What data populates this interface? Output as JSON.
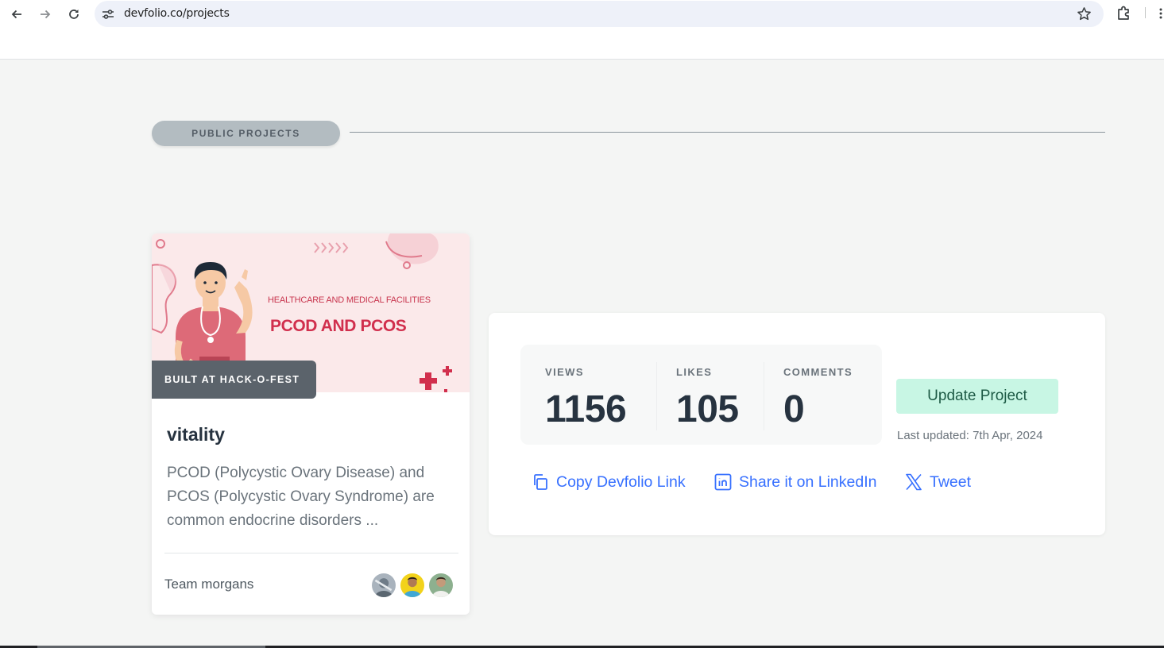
{
  "browser": {
    "url": "devfolio.co/projects",
    "icons": [
      "back-arrow-icon",
      "forward-arrow-icon",
      "reload-icon",
      "site-settings-icon",
      "star-icon",
      "extensions-icon",
      "menu-icon"
    ]
  },
  "section": {
    "label": "PUBLIC PROJECTS"
  },
  "project": {
    "cover": {
      "subtitle": "HEALTHCARE AND MEDICAL FACILITIES",
      "title": "PCOD AND PCOS"
    },
    "badge": "BUILT AT HACK-O-FEST",
    "name": "vitality",
    "description": "PCOD (Polycystic Ovary Disease) and PCOS (Polycystic Ovary Syndrome) are common endocrine disorders ...",
    "team": "Team morgans",
    "member_count": 3
  },
  "stats": {
    "views_label": "VIEWS",
    "views": "1156",
    "likes_label": "LIKES",
    "likes": "105",
    "comments_label": "COMMENTS",
    "comments": "0"
  },
  "actions": {
    "update_label": "Update Project",
    "last_updated": "Last updated: 7th Apr, 2024",
    "copy_link": "Copy Devfolio Link",
    "linkedin": "Share it on LinkedIn",
    "tweet": "Tweet"
  },
  "colors": {
    "accent_link": "#3770ff",
    "update_button_bg": "#c8f6e4",
    "update_button_text": "#1d5a45",
    "page_bg": "#f4f5f4",
    "cover_pink": "#d12f4d"
  }
}
